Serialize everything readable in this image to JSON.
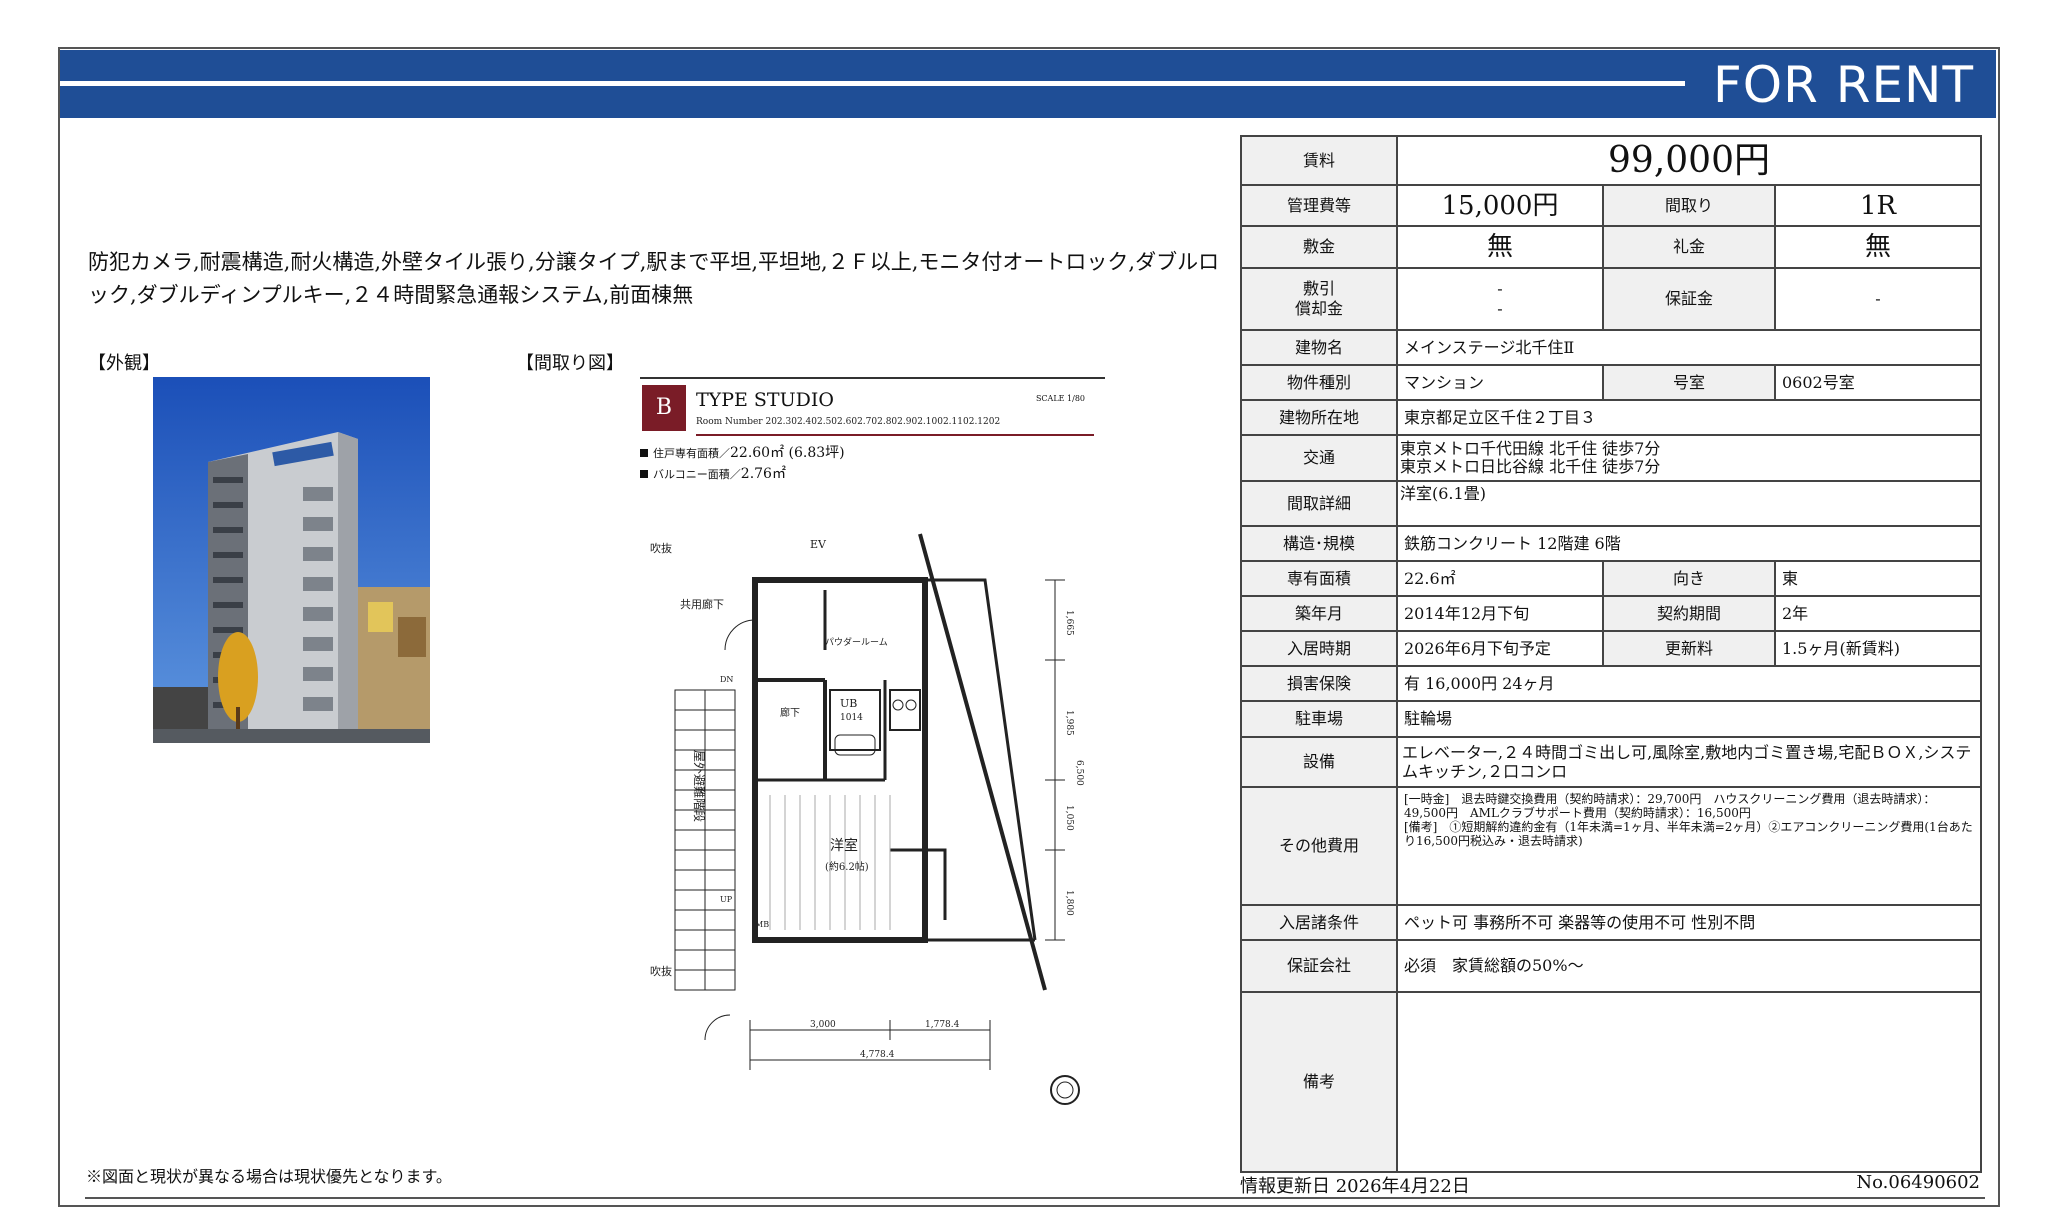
{
  "banner": {
    "title": "FOR RENT"
  },
  "features": "防犯カメラ,耐震構造,耐火構造,外壁タイル張り,分譲タイプ,駅まで平坦,平坦地,２Ｆ以上,モニタ付オートロック,ダブルロック,ダブルディンプルキー,２４時間緊急通報システム,前面棟無",
  "labels": {
    "exterior": "【外観】",
    "floorplan": "【間取り図】"
  },
  "floorplan": {
    "type_letter": "B",
    "type_name": "TYPE  STUDIO",
    "scale": "SCALE 1/80",
    "room_numbers": "Room Number 202.302.402.502.602.702.802.902.1002.1102.1202",
    "area_label": "住戸専有面積／",
    "area_value": "22.60㎡ (6.83坪)",
    "balcony_label": "バルコニー面積／",
    "balcony_value": "2.76㎡",
    "tags": {
      "ev": "EV",
      "fukinuke1": "吹抜",
      "kyoyo": "共用廊下",
      "powder": "パウダールーム",
      "ub": "UB",
      "ub_size": "1014",
      "roka": "廊下",
      "yoshitsu": "洋室",
      "yoshitsu_size": "(約6.2帖)",
      "okugai": "屋外避難階段",
      "fukinuke2": "吹抜",
      "mb": "MB",
      "dim_3000": "3,000",
      "dim_1778": "1,778.4",
      "dim_4778": "4,778.4",
      "dim_1665": "1,665",
      "dim_1985": "1,985",
      "dim_6500": "6,500",
      "dim_1050": "1,050",
      "dim_1800": "1,800",
      "dn": "DN",
      "up": "UP"
    }
  },
  "note": "※図面と現状が異なる場合は現状優先となります。",
  "info": {
    "rent_label": "賃料",
    "rent": "99,000円",
    "mgmt_label": "管理費等",
    "mgmt": "15,000円",
    "layout_label": "間取り",
    "layout": "1R",
    "deposit_label": "敷金",
    "deposit": "無",
    "key_money_label": "礼金",
    "key_money": "無",
    "shikibiki_label": "敷引",
    "shikibiki": "-",
    "shokyaku_label": "償却金",
    "shokyaku": "-",
    "guarantee_label": "保証金",
    "guarantee": "-",
    "building_label": "建物名",
    "building": "メインステージ北千住Ⅱ",
    "ptype_label": "物件種別",
    "ptype": "マンション",
    "room_label": "号室",
    "room": "0602号室",
    "address_label": "建物所在地",
    "address": "東京都足立区千住２丁目３",
    "access_label": "交通",
    "access1": "東京メトロ千代田線 北千住 徒歩7分",
    "access2": "東京メトロ日比谷線 北千住 徒歩7分",
    "layout_detail_label": "間取詳細",
    "layout_detail": "洋室(6.1畳)",
    "structure_label": "構造･規模",
    "structure": "鉄筋コンクリート 12階建 6階",
    "area_label": "専有面積",
    "area": "22.6㎡",
    "facing_label": "向き",
    "facing": "東",
    "built_label": "築年月",
    "built": "2014年12月下旬",
    "contract_label": "契約期間",
    "contract": "2年",
    "movein_label": "入居時期",
    "movein": "2026年6月下旬予定",
    "renewal_label": "更新料",
    "renewal": "1.5ヶ月(新賃料)",
    "insurance_label": "損害保険",
    "insurance": "有 16,000円 24ヶ月",
    "parking_label": "駐車場",
    "parking": "駐輪場",
    "equipment_label": "設備",
    "equipment": "エレベーター,２４時間ゴミ出し可,風除室,敷地内ゴミ置き場,宅配ＢＯＸ,システムキッチン,２口コンロ",
    "other_label": "その他費用",
    "other1": "[一時金]　退去時鍵交換費用（契約時請求）：29,700円　ハウスクリーニング費用（退去時請求）：49,500円　AMLクラブサポート費用（契約時請求）：16,500円",
    "other2": "[備考]　①短期解約違約金有（1年未満=1ヶ月、半年未満=2ヶ月）②エアコンクリーニング費用(1台あたり16,500円税込み・退去時請求)",
    "conditions_label": "入居諸条件",
    "conditions": "ペット可 事務所不可 楽器等の使用不可 性別不問",
    "gcompany_label": "保証会社",
    "gcompany": "必須　家賃総額の50%～",
    "remarks_label": "備考",
    "remarks": ""
  },
  "footer": {
    "update": "情報更新日 2026年4月22日",
    "docno": "No.06490602"
  }
}
